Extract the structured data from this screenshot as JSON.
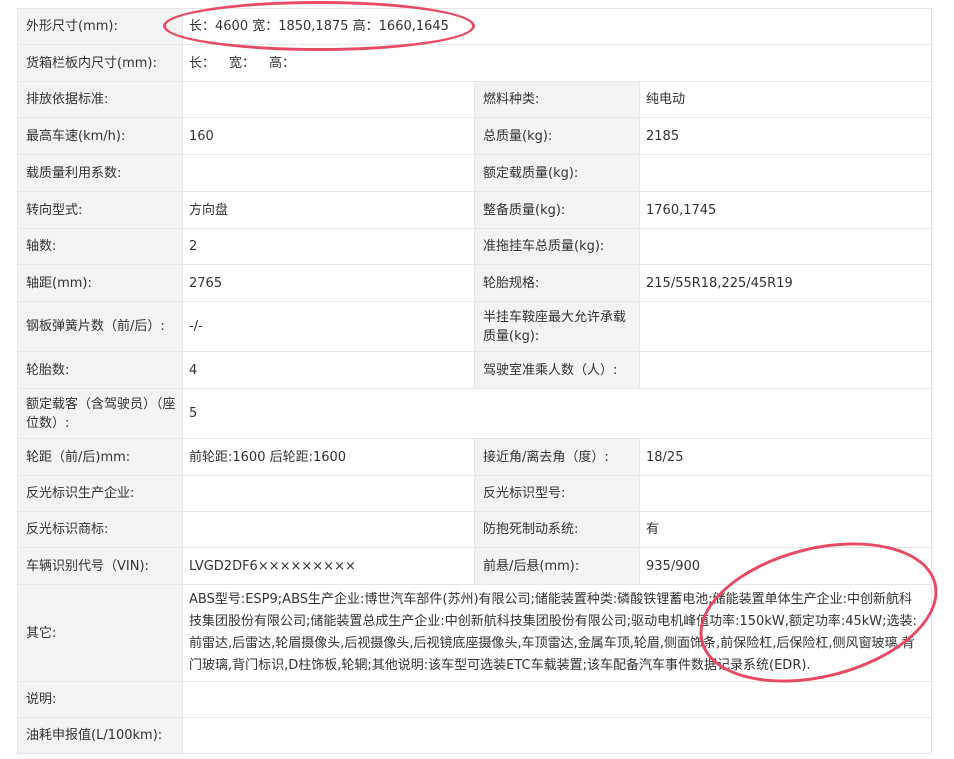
{
  "rows": [
    {
      "type": "wide",
      "label": "外形尺寸(mm):",
      "value": "长：4600 宽：1850,1875 高：1660,1645"
    },
    {
      "type": "wide",
      "label": "货箱栏板内尺寸(mm):",
      "v1": "长：",
      "v2": "宽：",
      "v3": "高："
    },
    {
      "type": "pair",
      "l1": "排放依据标准:",
      "v1": "",
      "l2": "燃料种类:",
      "v2": "纯电动"
    },
    {
      "type": "pair",
      "l1": "最高车速(km/h):",
      "v1": "160",
      "l2": "总质量(kg):",
      "v2": "2185"
    },
    {
      "type": "pair",
      "l1": "载质量利用系数:",
      "v1": "",
      "l2": "额定载质量(kg):",
      "v2": ""
    },
    {
      "type": "pair",
      "l1": "转向型式:",
      "v1": "方向盘",
      "l2": "整备质量(kg):",
      "v2": "1760,1745"
    },
    {
      "type": "pair",
      "l1": "轴数:",
      "v1": "2",
      "l2": "准拖挂车总质量(kg):",
      "v2": ""
    },
    {
      "type": "pair",
      "l1": "轴距(mm):",
      "v1": "2765",
      "l2": "轮胎规格:",
      "v2": "215/55R18,225/45R19"
    },
    {
      "type": "pair",
      "l1": "钢板弹簧片数（前/后）:",
      "v1": "-/-",
      "l2": "半挂车鞍座最大允许承载质量(kg):",
      "v2": ""
    },
    {
      "type": "pair",
      "l1": "轮胎数:",
      "v1": "4",
      "l2": "驾驶室准乘人数（人）:",
      "v2": ""
    },
    {
      "type": "wide",
      "label": "额定载客（含驾驶员）（座位数）:",
      "value": "5"
    },
    {
      "type": "pair",
      "l1": "轮距（前/后)mm:",
      "v1": "前轮距:1600 后轮距:1600",
      "l2": "接近角/离去角（度）:",
      "v2": "18/25"
    },
    {
      "type": "pair",
      "l1": "反光标识生产企业:",
      "v1": "",
      "l2": "反光标识型号:",
      "v2": ""
    },
    {
      "type": "pair",
      "l1": "反光标识商标:",
      "v1": "",
      "l2": "防抱死制动系统:",
      "v2": "有"
    },
    {
      "type": "pair",
      "l1": "车辆识别代号（VIN):",
      "v1": "LVGD2DF6×××××××××",
      "l2": "前悬/后悬(mm):",
      "v2": "935/900"
    },
    {
      "type": "wide",
      "label": "其它:",
      "value": "ABS型号:ESP9;ABS生产企业:博世汽车部件(苏州)有限公司;储能装置种类:磷酸铁锂蓄电池;储能装置单体生产企业:中创新航科技集团股份有限公司;储能装置总成生产企业:中创新航科技集团股份有限公司;驱动电机峰值功率:150kW,额定功率:45kW;选装:前雷达,后雷达,轮眉摄像头,后视摄像头,后视镜底座摄像头,车顶雷达,金属车顶,轮眉,侧面饰条,前保险杠,后保险杠,侧风窗玻璃,背门玻璃,背门标识,D柱饰板,轮辋;其他说明:该车型可选装ETC车载装置;该车配备汽车事件数据记录系统(EDR)."
    },
    {
      "type": "wide",
      "label": "说明:",
      "value": ""
    },
    {
      "type": "wide",
      "label": "油耗申报值(L/100km):",
      "value": ""
    }
  ],
  "annotation_color": "#e94a63"
}
